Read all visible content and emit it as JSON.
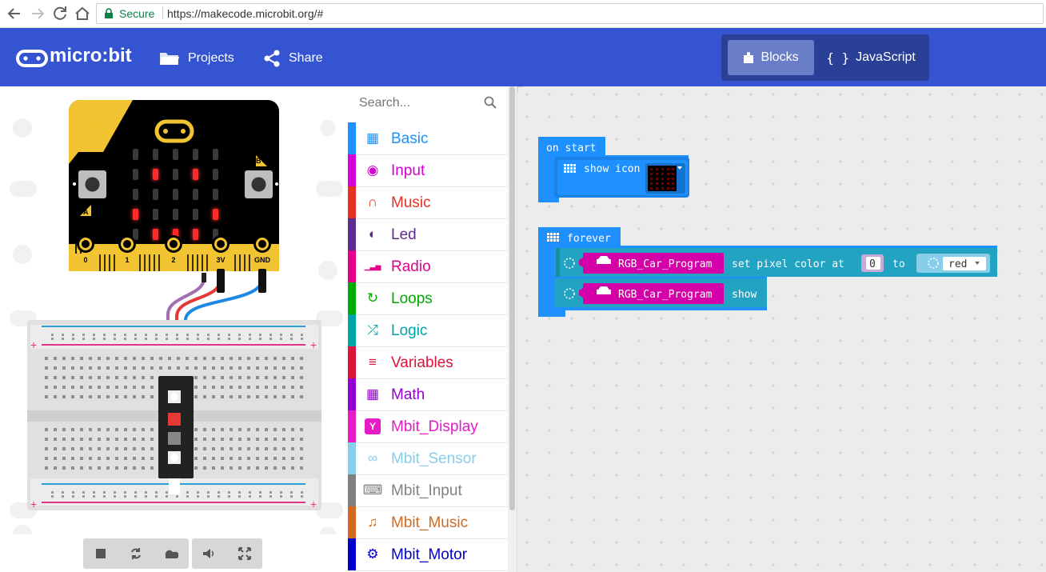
{
  "browser": {
    "secure_label": "Secure",
    "url": "https://makecode.microbit.org/#"
  },
  "header": {
    "logo_text": "micro:bit",
    "projects_label": "Projects",
    "share_label": "Share",
    "blocks_label": "Blocks",
    "javascript_label": "JavaScript",
    "brand_color": "#3454d1"
  },
  "simulator": {
    "button_a": "A",
    "button_b": "B",
    "pins": [
      "0",
      "1",
      "2",
      "3V",
      "GND"
    ],
    "led_matrix": [
      [
        0,
        0,
        0,
        0,
        0
      ],
      [
        0,
        1,
        0,
        1,
        0
      ],
      [
        0,
        0,
        0,
        0,
        0
      ],
      [
        1,
        0,
        0,
        0,
        1
      ],
      [
        0,
        1,
        1,
        1,
        0
      ]
    ],
    "controls": [
      "stop-icon",
      "restart-icon",
      "slowmo-icon",
      "mute-icon",
      "fullscreen-icon"
    ]
  },
  "toolbox": {
    "search_placeholder": "Search...",
    "categories": [
      {
        "label": "Basic",
        "color": "#1e90ff",
        "icon": "grid-icon"
      },
      {
        "label": "Input",
        "color": "#d400d4",
        "icon": "target-icon"
      },
      {
        "label": "Music",
        "color": "#e63022",
        "icon": "headphones-icon"
      },
      {
        "label": "Led",
        "color": "#5c2d91",
        "icon": "toggle-icon"
      },
      {
        "label": "Radio",
        "color": "#e3008c",
        "icon": "signal-icon"
      },
      {
        "label": "Loops",
        "color": "#00aa00",
        "icon": "refresh-icon"
      },
      {
        "label": "Logic",
        "color": "#00a4a6",
        "icon": "shuffle-icon"
      },
      {
        "label": "Variables",
        "color": "#dc143c",
        "icon": "list-icon"
      },
      {
        "label": "Math",
        "color": "#9400d3",
        "icon": "calculator-icon"
      },
      {
        "label": "Mbit_Display",
        "color": "#e61ac6",
        "icon": "y-badge-icon"
      },
      {
        "label": "Mbit_Sensor",
        "color": "#87ceeb",
        "icon": "steam-icon"
      },
      {
        "label": "Mbit_Input",
        "color": "#808080",
        "icon": "keyboard-icon"
      },
      {
        "label": "Mbit_Music",
        "color": "#d2691e",
        "icon": "note-icon"
      },
      {
        "label": "Mbit_Motor",
        "color": "#0000cd",
        "icon": "gear-icon"
      }
    ]
  },
  "workspace": {
    "on_start": {
      "label": "on start",
      "show_icon": "show icon"
    },
    "forever": {
      "label": "forever",
      "line1_var": "RGB_Car_Program",
      "line1_text": "set pixel color at",
      "line1_value": "0",
      "line1_to": "to",
      "line1_color": "red",
      "line2_var": "RGB_Car_Program",
      "line2_text": "show"
    }
  }
}
